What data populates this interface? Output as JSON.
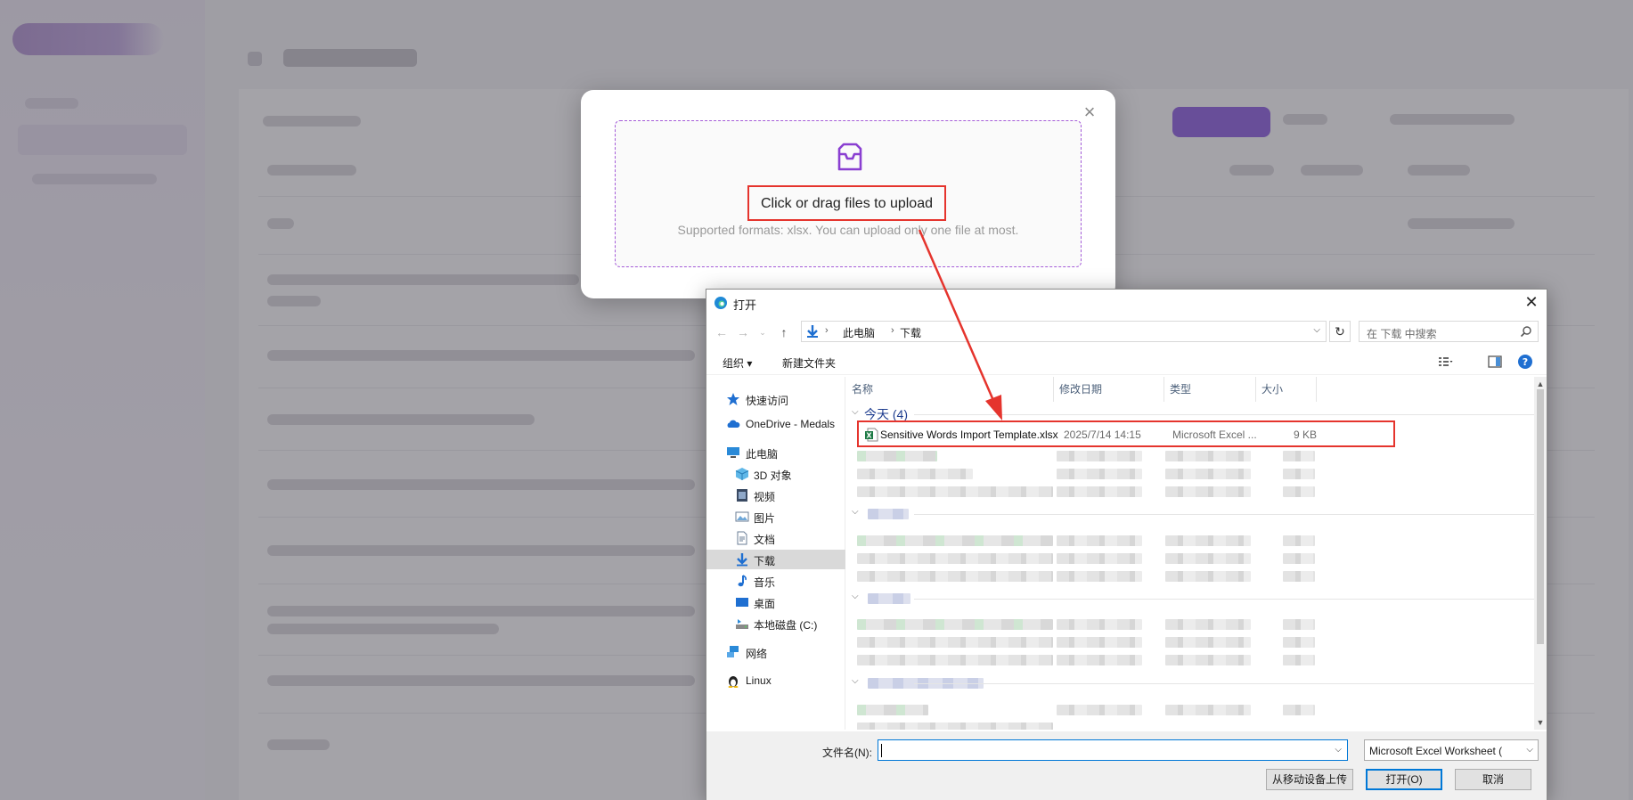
{
  "upload_modal": {
    "title": "Click or drag files to upload",
    "hint": "Supported formats: xlsx. You can upload only one file at most.",
    "close_glyph": "×"
  },
  "dialog": {
    "title": "打开",
    "close_glyph": "✕",
    "address": {
      "pc": "此电脑",
      "folder": "下载"
    },
    "search_placeholder": "在 下载 中搜索",
    "toolbar": {
      "organize": "组织 ▾",
      "new_folder": "新建文件夹"
    },
    "nav": {
      "quick_access": "快速访问",
      "onedrive": "OneDrive - Medals",
      "this_pc": "此电脑",
      "objects_3d": "3D 对象",
      "videos": "视频",
      "pictures": "图片",
      "documents": "文档",
      "downloads": "下载",
      "music": "音乐",
      "desktop": "桌面",
      "local_disk": "本地磁盘 (C:)",
      "network": "网络",
      "linux": "Linux"
    },
    "columns": {
      "name": "名称",
      "date": "修改日期",
      "type": "类型",
      "size": "大小"
    },
    "group_today": "今天 (4)",
    "file": {
      "name": "Sensitive Words Import Template.xlsx",
      "date": "2025/7/14 14:15",
      "type": "Microsoft Excel ...",
      "size": "9 KB"
    },
    "filename_label": "文件名(N):",
    "filename_value": "",
    "filetype_value": "Microsoft Excel Worksheet (",
    "buttons": {
      "mobile_upload": "从移动设备上传",
      "open": "打开(O)",
      "cancel": "取消"
    }
  },
  "colors": {
    "accent_purple": "#6d2fd9",
    "highlight_red": "#e5342d",
    "win_blue": "#0078d7"
  }
}
